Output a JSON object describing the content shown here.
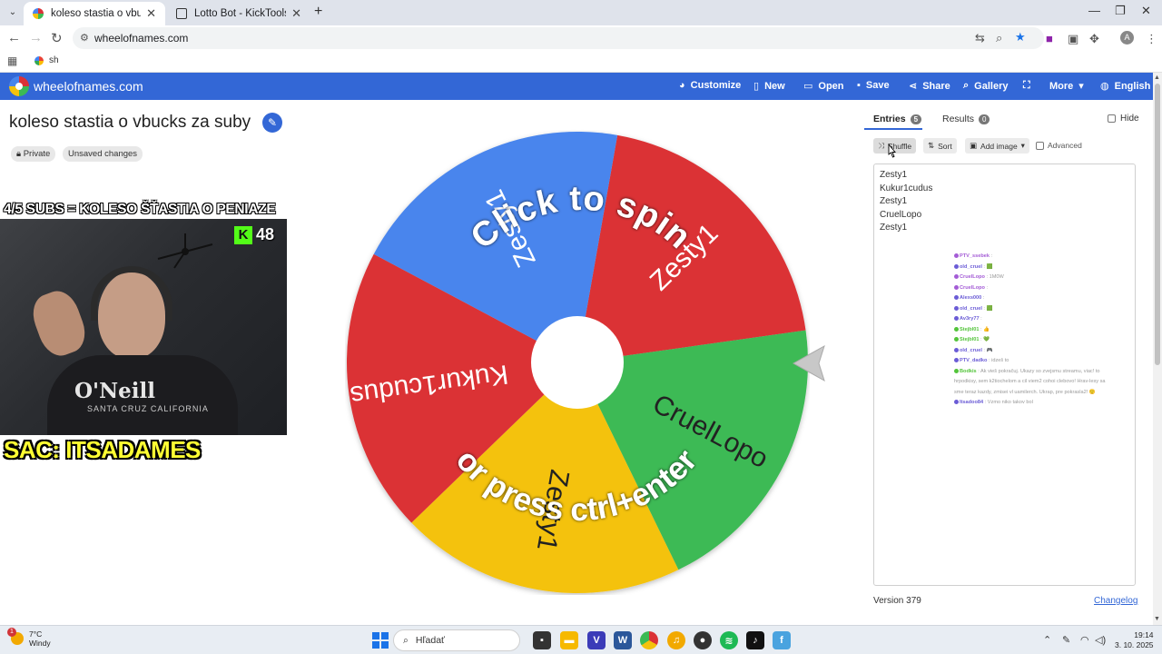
{
  "browser": {
    "tabs": [
      {
        "title": "koleso stastia o vbucks za suby",
        "close": "✕"
      },
      {
        "title": "Lotto Bot - KickTools",
        "close": "✕"
      }
    ],
    "new_tab": "+",
    "url": "wheelofnames.com",
    "bookmark": "sh",
    "window_controls": [
      "—",
      "❐",
      "✕"
    ]
  },
  "app": {
    "brand": "wheelofnames.com",
    "nav": [
      {
        "label": "Customize",
        "icon": "palette-icon"
      },
      {
        "label": "New",
        "icon": "file-icon"
      },
      {
        "label": "Open",
        "icon": "folder-icon"
      },
      {
        "label": "Save",
        "icon": "save-icon"
      },
      {
        "label": "Share",
        "icon": "share-icon"
      },
      {
        "label": "Gallery",
        "icon": "search-icon"
      },
      {
        "label": "",
        "icon": "fullscreen-icon"
      },
      {
        "label": "More",
        "icon": "chevron-down-icon"
      },
      {
        "label": "English",
        "icon": "globe-icon"
      }
    ]
  },
  "wheel": {
    "title": "koleso stastia o vbucks za suby",
    "chips": [
      "Private",
      "Unsaved changes"
    ],
    "segment_colors": [
      "#db3236",
      "#3cba54",
      "#f4c20d",
      "#db3236",
      "#4885ed"
    ],
    "segment_labels": [
      "Zesty1",
      "CruelLopo",
      "Zesty1",
      "Kukur1cudus",
      "Zesty1"
    ],
    "spin_text_top": "Click to spin",
    "spin_text_bottom": "or press ctrl+enter"
  },
  "stream": {
    "overlay_top": "4/5 SUBS = KOLESO ŠŤASTIA O PENIAZE",
    "kick_count": "48",
    "kick_letter": "K",
    "shirt_text": "O'Neill",
    "shirt_sub": "SANTA CRUZ CALIFORNIA",
    "overlay_bottom": "SAC: ITSADAMES"
  },
  "panel": {
    "tabs": [
      {
        "label": "Entries",
        "count": "5"
      },
      {
        "label": "Results",
        "count": "0"
      }
    ],
    "hide_label": "Hide",
    "buttons": [
      "Shuffle",
      "Sort",
      "Add image"
    ],
    "advanced_label": "Advanced",
    "entries": [
      "Zesty1",
      "Kukur1cudus",
      "Zesty1",
      "CruelLopo",
      "Zesty1"
    ],
    "chat": [
      {
        "user": "PTV_ssebek",
        "color": "#a45cd6",
        "msg": ": ㅤ"
      },
      {
        "user": "old_cruel",
        "color": "#6b5cd6",
        "msg": ": 🟩"
      },
      {
        "user": "CruelLopo",
        "color": "#a45cd6",
        "msg": ": 1M0W"
      },
      {
        "user": "CruelLopo",
        "color": "#a45cd6",
        "msg": ": ㅤ"
      },
      {
        "user": "Alexs000",
        "color": "#6b5cd6",
        "msg": ": ㅤ"
      },
      {
        "user": "old_cruel",
        "color": "#6b5cd6",
        "msg": ": 🟩"
      },
      {
        "user": "Av3ry77",
        "color": "#6b5cd6",
        "msg": ": ㅤ"
      },
      {
        "user": "Stejbl01",
        "color": "#53c43a",
        "msg": ": 👍"
      },
      {
        "user": "Stejbl01",
        "color": "#53c43a",
        "msg": ": 💚"
      },
      {
        "user": "old_cruel",
        "color": "#6b5cd6",
        "msg": ": 🎮"
      },
      {
        "user": "PTV_dadko",
        "color": "#6b5cd6",
        "msg": ": idzeš to"
      },
      {
        "user": "Bodkis",
        "color": "#53c43a",
        "msg": ": Ak vieš pokračuj. Ukazy so zvejsmu streamu, viac! to"
      },
      {
        "user": "",
        "color": "",
        "msg": "hrpodkisy, sem k2tiochelom a cil viem2 cohoi clebovo! Hrav-lesy sa"
      },
      {
        "user": "",
        "color": "",
        "msg": "sme teraz kazdy, zmisei vl uamilerch. Ukrap, pre pokrasla2! 🙂"
      },
      {
        "user": "Itsadoo84",
        "color": "#6b5cd6",
        "msg": ": Vzmo niko takov bol"
      }
    ],
    "version": "Version 379",
    "changelog": "Changelog"
  },
  "taskbar": {
    "weather_temp": "7°C",
    "weather_text": "Windy",
    "weather_badge": "1",
    "search_label": "Hľadať",
    "time": "19:14",
    "date": "3. 10. 2025"
  }
}
